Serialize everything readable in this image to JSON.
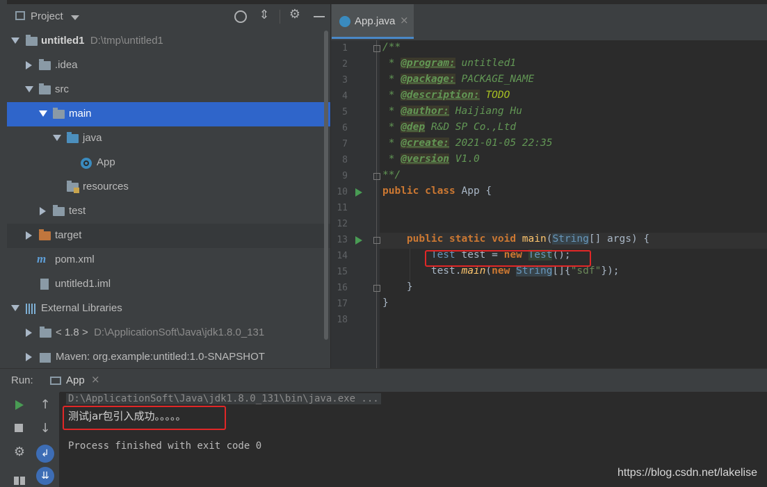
{
  "project_panel": {
    "title": "Project",
    "tree": [
      {
        "label": "untitled1",
        "path": "D:\\tmp\\untitled1"
      },
      {
        "label": ".idea"
      },
      {
        "label": "src"
      },
      {
        "label": "main"
      },
      {
        "label": "java"
      },
      {
        "label": "App"
      },
      {
        "label": "resources"
      },
      {
        "label": "test"
      },
      {
        "label": "target"
      },
      {
        "label": "pom.xml"
      },
      {
        "label": "untitled1.iml"
      },
      {
        "label": "External Libraries"
      },
      {
        "label": "< 1.8 >",
        "path": "D:\\ApplicationSoft\\Java\\jdk1.8.0_131"
      },
      {
        "label": "Maven: org.example:untitled:1.0-SNAPSHOT"
      }
    ],
    "icons": [
      "target-icon",
      "collapse-all-icon",
      "gear-icon",
      "minimize-icon"
    ]
  },
  "editor": {
    "tab_label": "App.java",
    "line_numbers": [
      "1",
      "2",
      "3",
      "4",
      "5",
      "6",
      "7",
      "8",
      "9",
      "10",
      "11",
      "12",
      "13",
      "14",
      "15",
      "16",
      "17",
      "18"
    ],
    "lines": {
      "l1": "/**",
      "l2_tag": "@program:",
      "l2_val": " untitled1",
      "l3_tag": "@package:",
      "l3_val": " PACKAGE_NAME",
      "l4_tag": "@description:",
      "l4_val": " TODO",
      "l5_tag": "@author:",
      "l5_val": " Haijiang Hu",
      "l6_tag": "@dep",
      "l6_val": " R&D SP Co.,Ltd",
      "l7_tag": "@create:",
      "l7_val": " 2021-01-05 22:35",
      "l8_tag": "@version",
      "l8_val": " V1.0",
      "l9": "**/",
      "star": " * "
    }
  },
  "run_panel": {
    "label": "Run:",
    "tab_label": "App",
    "console": [
      "D:\\ApplicationSoft\\Java\\jdk1.8.0_131\\bin\\java.exe ...",
      "测试jar包引入成功。。。。。",
      "Process finished with exit code 0"
    ]
  },
  "watermark": "https://blog.csdn.net/lakelise",
  "colors": {
    "selection": "#2f65ca",
    "keyword": "#cc7832",
    "comment": "#629755",
    "highlight_box": "#e12727"
  }
}
